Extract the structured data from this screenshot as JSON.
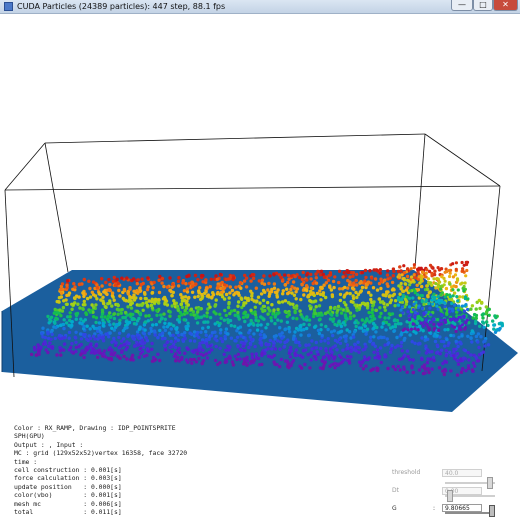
{
  "window": {
    "title": "CUDA Particles (24389 particles): 447 step, 88.1 fps",
    "controls": {
      "minimize": "—",
      "maximize": "□",
      "close": "✕"
    }
  },
  "colors": {
    "floor": "#1b5f9e",
    "titlebar": "#c3d3e6",
    "close_button": "#c74b3c"
  },
  "hud": {
    "lines": [
      "Color : RX_RAMP, Drawing : IDP_POINTSPRITE",
      "SPH(GPU)",
      "Output : , Input :",
      "MC : grid (129x52x52)vertex 16358, face 32720",
      "time :",
      "cell construction : 0.001[s]",
      "force calculation : 0.003[s]",
      "update position   : 0.000[s]",
      "color(vbo)        : 0.001[s]",
      "mesh mc           : 0.006[s]",
      "total             : 0.011[s]"
    ]
  },
  "controls": {
    "threshold": {
      "label": "threshold",
      "value": "40.0",
      "level": 0.95
    },
    "dt": {
      "label": "Dt",
      "value": "0.00",
      "level": 0.05
    },
    "g": {
      "label": "G",
      "value": "9.80665",
      "level": 1.0
    }
  }
}
